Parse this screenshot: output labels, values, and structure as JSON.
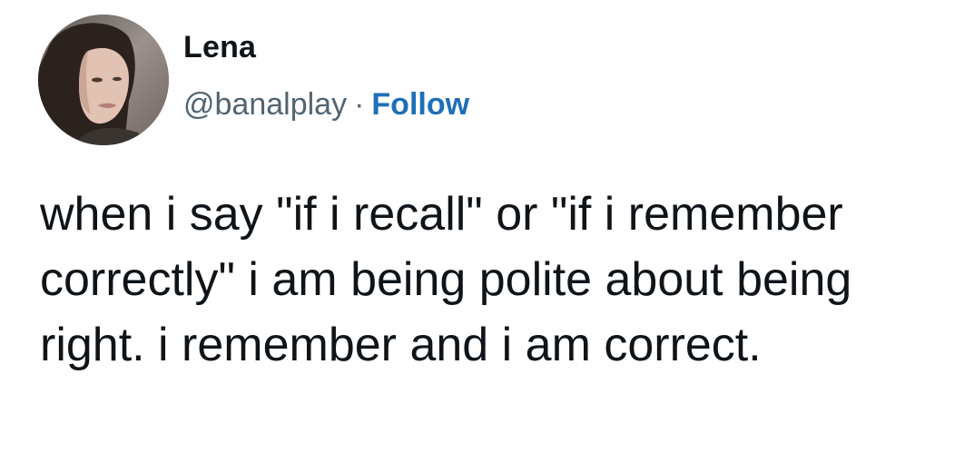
{
  "author": {
    "name": "Lena",
    "handle": "@banalplay",
    "separator": "·",
    "follow_label": "Follow"
  },
  "tweet": {
    "text": "when i say \"if i recall\" or \"if i remember correctly\" i am being polite about being right. i remember and i am correct."
  },
  "colors": {
    "follow": "#1d6fb8",
    "text": "#0f1419",
    "secondary": "#536471"
  }
}
